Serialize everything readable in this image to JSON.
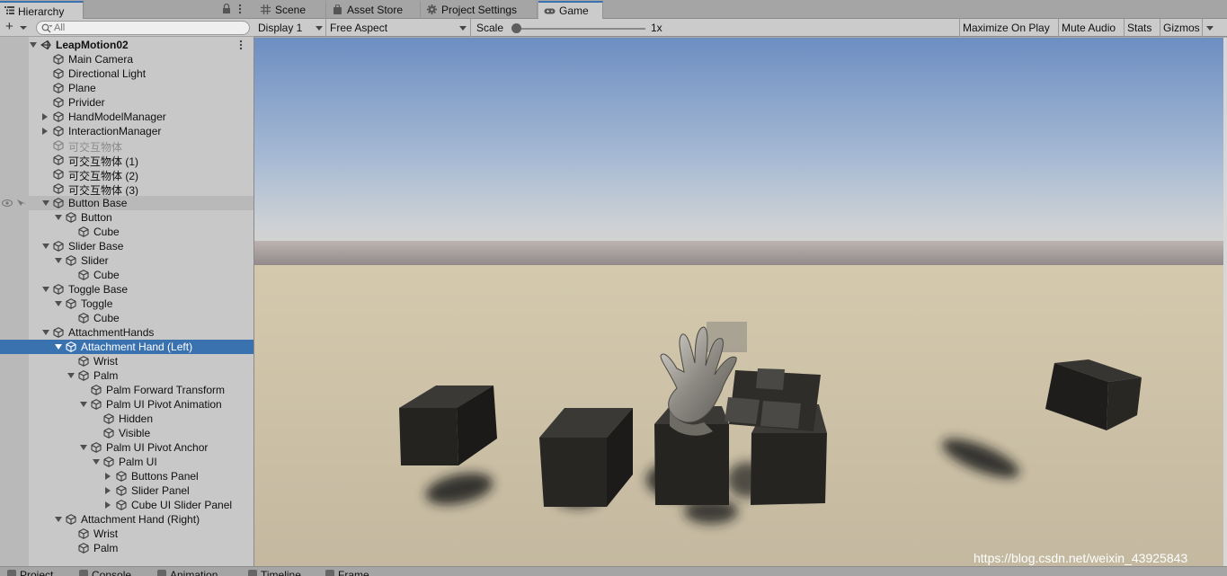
{
  "hierarchy": {
    "tab_label": "Hierarchy",
    "search_placeholder": "All",
    "scene": "LeapMotion02",
    "items": [
      {
        "label": "Main Camera"
      },
      {
        "label": "Directional Light"
      },
      {
        "label": "Plane"
      },
      {
        "label": "Privider"
      },
      {
        "label": "HandModelManager"
      },
      {
        "label": "InteractionManager"
      },
      {
        "label": "可交互物体"
      },
      {
        "label": "可交互物体 (1)"
      },
      {
        "label": "可交互物体 (2)"
      },
      {
        "label": "可交互物体 (3)"
      },
      {
        "label": "Button Base"
      },
      {
        "label": "Button"
      },
      {
        "label": "Cube"
      },
      {
        "label": "Slider Base"
      },
      {
        "label": "Slider"
      },
      {
        "label": "Cube"
      },
      {
        "label": "Toggle Base"
      },
      {
        "label": "Toggle"
      },
      {
        "label": "Cube"
      },
      {
        "label": "AttachmentHands"
      },
      {
        "label": "Attachment Hand (Left)"
      },
      {
        "label": "Wrist"
      },
      {
        "label": "Palm"
      },
      {
        "label": "Palm Forward Transform"
      },
      {
        "label": "Palm UI Pivot Animation"
      },
      {
        "label": "Hidden"
      },
      {
        "label": "Visible"
      },
      {
        "label": "Palm UI Pivot Anchor"
      },
      {
        "label": "Palm UI"
      },
      {
        "label": "Buttons Panel"
      },
      {
        "label": "Slider Panel"
      },
      {
        "label": "Cube UI Slider Panel"
      },
      {
        "label": "Attachment Hand (Right)"
      },
      {
        "label": "Wrist"
      },
      {
        "label": "Palm"
      }
    ]
  },
  "tabs": [
    {
      "label": "Scene",
      "icon": "grid-icon"
    },
    {
      "label": "Asset Store",
      "icon": "store-bag-icon"
    },
    {
      "label": "Project Settings",
      "icon": "gear-icon"
    },
    {
      "label": "Game",
      "icon": "gamepad-icon"
    }
  ],
  "toolbar": {
    "display": "Display 1",
    "aspect": "Free Aspect",
    "scale_label": "Scale",
    "scale_value": "1x",
    "scale_level": 0,
    "maximize": "Maximize On Play",
    "mute": "Mute Audio",
    "stats": "Stats",
    "gizmos": "Gizmos"
  },
  "bottom_tabs": [
    {
      "label": "Project",
      "icon": "folder-icon"
    },
    {
      "label": "Console",
      "icon": "console-icon"
    },
    {
      "label": "Animation",
      "icon": "animation-icon"
    },
    {
      "label": "Timeline",
      "icon": "timeline-icon"
    },
    {
      "label": "Frame Debug",
      "icon": "frame-debug-icon"
    }
  ],
  "watermark": "https://blog.csdn.net/weixin_43925843",
  "colors": {
    "selection": "#3a72b0",
    "sky_top": "#6f90c2",
    "ground": "#cdc2a6"
  }
}
